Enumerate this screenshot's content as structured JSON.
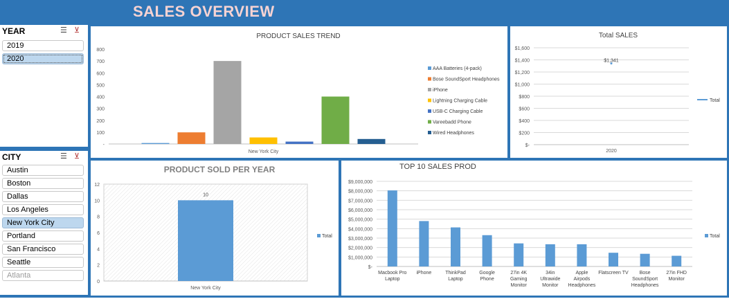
{
  "header": {
    "title": "SALES OVERVIEW"
  },
  "year_slicer": {
    "title": "YEAR",
    "items": [
      {
        "label": "2019",
        "selected": false
      },
      {
        "label": "2020",
        "selected": true
      }
    ]
  },
  "city_slicer": {
    "title": "CITY",
    "items": [
      {
        "label": "Austin",
        "selected": false
      },
      {
        "label": "Boston",
        "selected": false
      },
      {
        "label": "Dallas",
        "selected": false
      },
      {
        "label": "Los Angeles",
        "selected": false
      },
      {
        "label": "New York City",
        "selected": true
      },
      {
        "label": "Portland",
        "selected": false
      },
      {
        "label": "San Francisco",
        "selected": false
      },
      {
        "label": "Seattle",
        "selected": false
      },
      {
        "label": "Atlanta",
        "selected": false,
        "dimmed": true
      }
    ]
  },
  "icons": {
    "multi_select": "multi-select-icon",
    "clear_filter": "clear-filter-icon"
  },
  "chart_data": [
    {
      "id": "trend",
      "type": "bar",
      "title": "PRODUCT SALES TREND",
      "categories": [
        "New York City"
      ],
      "ylim": [
        0,
        800
      ],
      "yticks": [
        "-",
        "100",
        "200",
        "300",
        "400",
        "500",
        "600",
        "700",
        "800"
      ],
      "series": [
        {
          "name": "AAA Batteries (4-pack)",
          "color": "#5b9bd5",
          "values": [
            8
          ]
        },
        {
          "name": "Bose SoundSport Headphones",
          "color": "#ed7d31",
          "values": [
            98
          ]
        },
        {
          "name": "iPhone",
          "color": "#a5a5a5",
          "values": [
            700
          ]
        },
        {
          "name": "Lightning Charging Cable",
          "color": "#ffc000",
          "values": [
            55
          ]
        },
        {
          "name": "USB-C Charging Cable",
          "color": "#4472c4",
          "values": [
            20
          ]
        },
        {
          "name": "Vareebadd Phone",
          "color": "#70ad47",
          "values": [
            400
          ]
        },
        {
          "name": "Wired Headphones",
          "color": "#255e91",
          "values": [
            42
          ]
        }
      ],
      "legend": "right"
    },
    {
      "id": "total",
      "type": "line",
      "title": "Total SALES",
      "categories": [
        "2020"
      ],
      "ylim": [
        0,
        1600
      ],
      "yticks": [
        "$-",
        "$200",
        "$400",
        "$600",
        "$800",
        "$1,000",
        "$1,200",
        "$1,400",
        "$1,600"
      ],
      "series": [
        {
          "name": "Total",
          "color": "#5b9bd5",
          "values": [
            1341
          ]
        }
      ],
      "data_labels": [
        "$1,341"
      ],
      "legend": "right"
    },
    {
      "id": "per_year",
      "type": "bar",
      "title": "PRODUCT SOLD PER YEAR",
      "categories": [
        "New York City"
      ],
      "ylim": [
        0,
        12
      ],
      "yticks": [
        "0",
        "2",
        "4",
        "6",
        "8",
        "10",
        "12"
      ],
      "series": [
        {
          "name": "Total",
          "color": "#5b9bd5",
          "values": [
            10
          ]
        }
      ],
      "data_labels": [
        "10"
      ],
      "legend": "right"
    },
    {
      "id": "top10",
      "type": "bar",
      "title": "TOP 10 SALES PROD",
      "categories": [
        "Macbook Pro Laptop",
        "iPhone",
        "ThinkPad Laptop",
        "Google Phone",
        "27in 4K Gaming Monitor",
        "34in Ultrawide Monitor",
        "Apple Airpods Headphones",
        "Flatscreen TV",
        "Bose SoundSport Headphones",
        "27in FHD Monitor"
      ],
      "category_lines": [
        [
          "Macbook Pro",
          "Laptop"
        ],
        [
          "iPhone"
        ],
        [
          "ThinkPad",
          "Laptop"
        ],
        [
          "Google",
          "Phone"
        ],
        [
          "27in 4K",
          "Gaming",
          "Monitor"
        ],
        [
          "34in",
          "Ultrawide",
          "Monitor"
        ],
        [
          "Apple",
          "Airpods",
          "Headphones"
        ],
        [
          "Flatscreen TV"
        ],
        [
          "Bose",
          "SoundSport",
          "Headphones"
        ],
        [
          "27in FHD",
          "Monitor"
        ]
      ],
      "ylim": [
        0,
        9000000
      ],
      "yticks": [
        "$-",
        "$1,000,000",
        "$2,000,000",
        "$3,000,000",
        "$4,000,000",
        "$5,000,000",
        "$6,000,000",
        "$7,000,000",
        "$8,000,000",
        "$9,000,000"
      ],
      "series": [
        {
          "name": "Total",
          "color": "#5b9bd5",
          "values": [
            8040000,
            4800000,
            4130000,
            3310000,
            2440000,
            2350000,
            2350000,
            1450000,
            1340000,
            1130000
          ]
        }
      ],
      "legend": "right"
    }
  ]
}
